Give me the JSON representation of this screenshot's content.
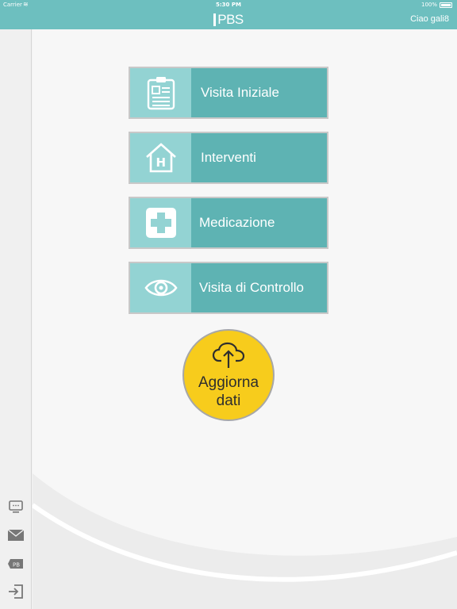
{
  "status_bar": {
    "carrier": "Carrier",
    "time": "5:30 PM",
    "battery": "100%"
  },
  "header": {
    "logo_text": "PBS",
    "greeting": "Ciao gali8"
  },
  "menu": [
    {
      "label": "Visita Iniziale",
      "icon": "clipboard-icon"
    },
    {
      "label": "Interventi",
      "icon": "hospital-house-icon"
    },
    {
      "label": "Medicazione",
      "icon": "medical-cross-icon"
    },
    {
      "label": "Visita di Controllo",
      "icon": "eye-icon"
    }
  ],
  "update_button": {
    "line1": "Aggiorna",
    "line2": "dati",
    "icon": "cloud-upload-icon"
  },
  "sidebar": [
    "chat-monitor-icon",
    "mail-icon",
    "tag-icon",
    "logout-icon"
  ],
  "colors": {
    "header": "#6dbfbf",
    "button": "#5eb3b3",
    "icon_box": "#93d3d3",
    "update": "#f7cc1c"
  }
}
